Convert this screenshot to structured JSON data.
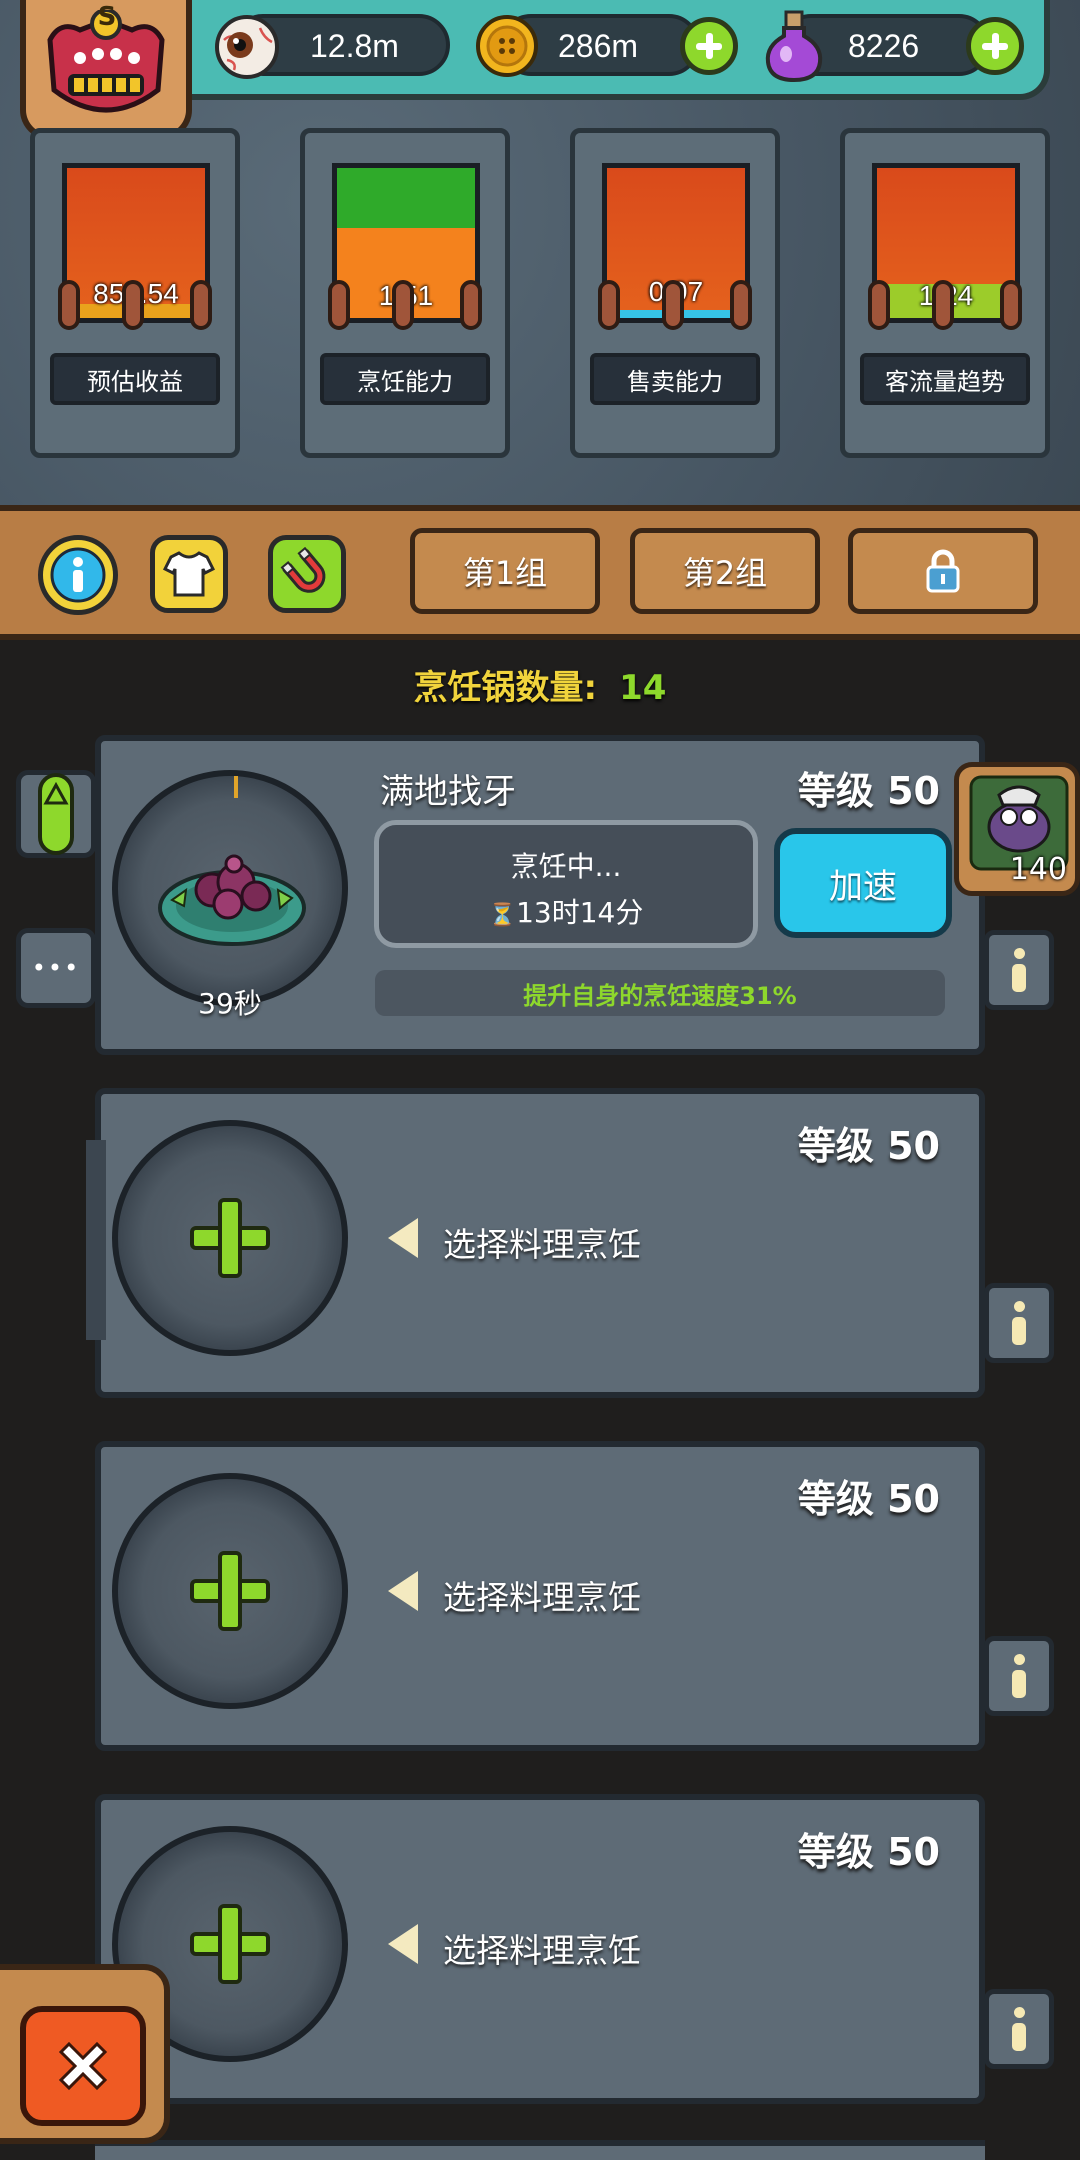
{
  "resources": {
    "eyes": "12.8m",
    "coins": "286m",
    "potions": "8226"
  },
  "badge": {
    "letter": "S"
  },
  "stats": [
    {
      "value": "855.54",
      "label": "预估收益"
    },
    {
      "value": "1.51",
      "label": "烹饪能力"
    },
    {
      "value": "0.97",
      "label": "售卖能力"
    },
    {
      "value": "1.24",
      "label": "客流量趋势"
    }
  ],
  "toolbar": {
    "group1": "第1组",
    "group2": "第2组"
  },
  "pot_count": {
    "label": "烹饪锅数量:",
    "value": "14"
  },
  "active_slot": {
    "dish": "满地找牙",
    "level": "等级 50",
    "status": "烹饪中...",
    "time": "13时14分",
    "hourglass": "⏳",
    "speed_button": "加速",
    "timer": "39秒",
    "bonus": "提升自身的烹饪速度31%",
    "chef_count": "140",
    "dots": "•••"
  },
  "empty_slots": [
    {
      "level": "等级 50",
      "prompt": "选择料理烹饪"
    },
    {
      "level": "等级 50",
      "prompt": "选择料理烹饪"
    },
    {
      "level": "等级 50",
      "prompt": "选择料理烹饪"
    }
  ],
  "icons": [
    "eyeball-icon",
    "coin-icon",
    "potion-icon",
    "info-icon",
    "shirt-icon",
    "magnet-icon",
    "lock-icon",
    "close-icon"
  ],
  "colors": {
    "accent_green": "#8ed82c",
    "title_yellow": "#f1d43c",
    "speed_blue": "#29c6ea",
    "close_orange": "#ef5a23"
  }
}
